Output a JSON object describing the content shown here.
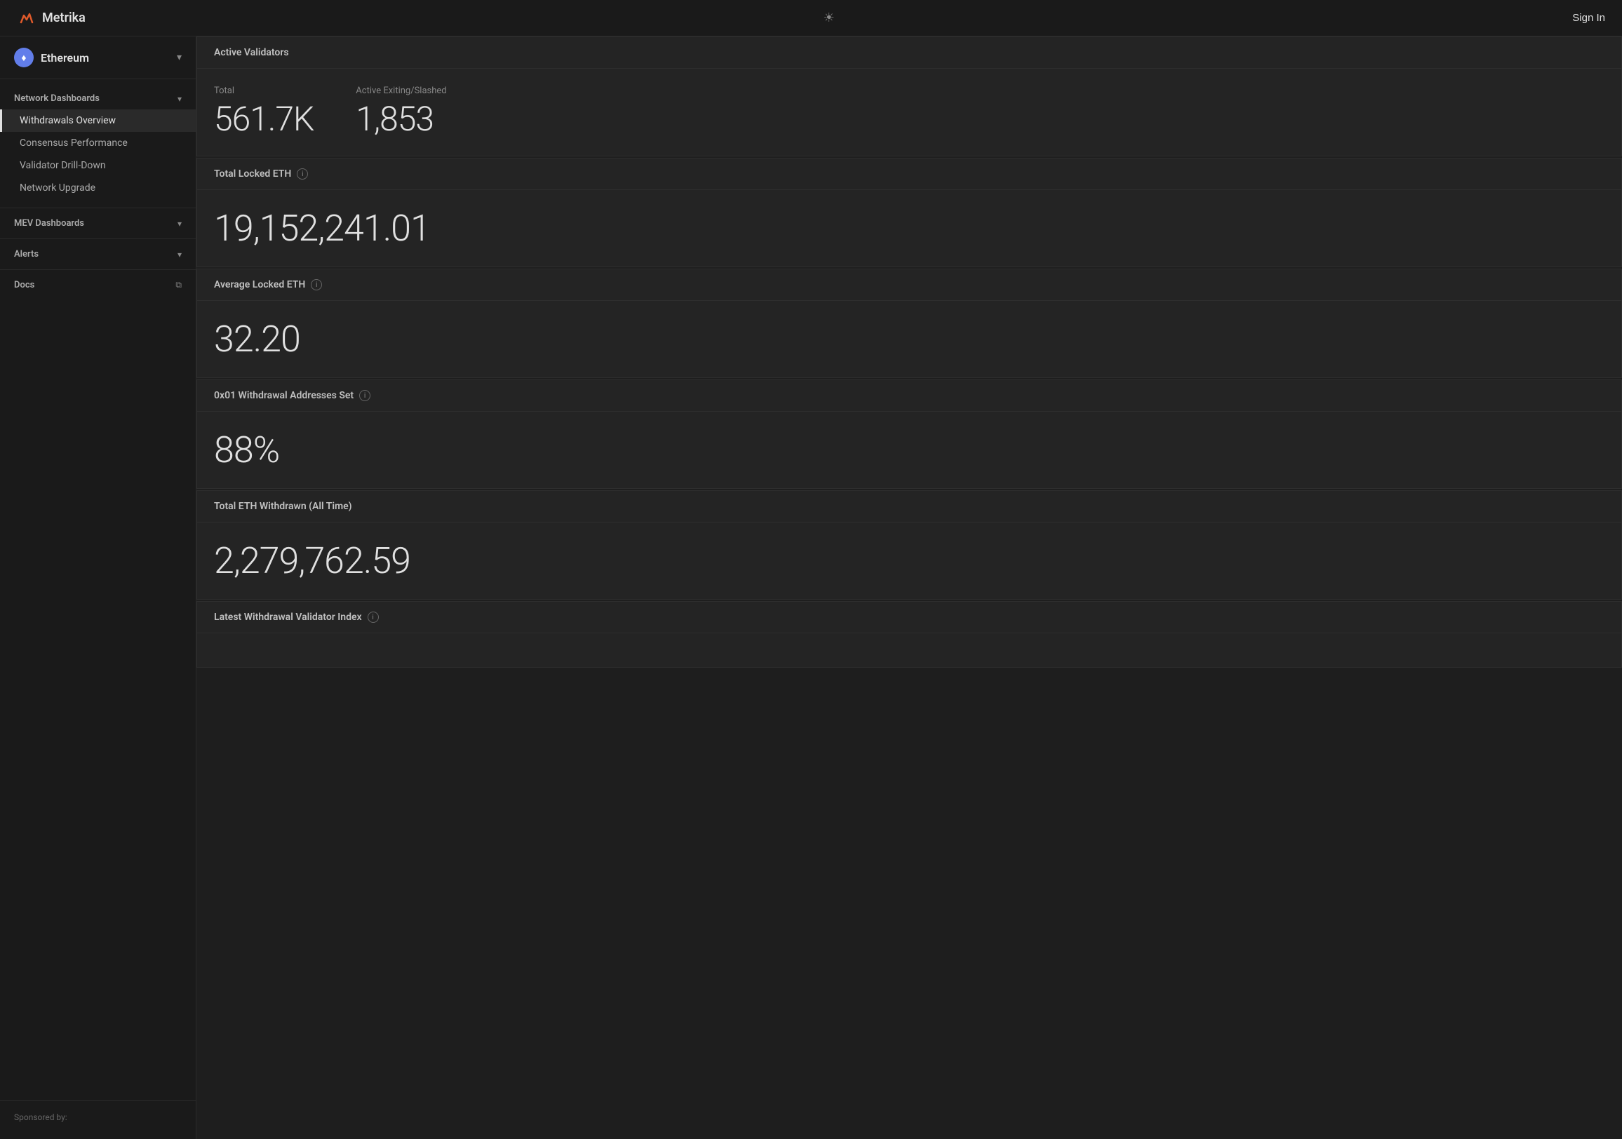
{
  "app": {
    "name": "Metrika",
    "sign_in_label": "Sign In"
  },
  "theme_icon": "☀",
  "network_selector": {
    "name": "Ethereum",
    "chevron": "▾"
  },
  "sidebar": {
    "network_dashboards_label": "Network Dashboards",
    "network_dashboards_chevron": "▾",
    "nav_items": [
      {
        "label": "Withdrawals Overview",
        "active": true
      },
      {
        "label": "Consensus Performance",
        "active": false
      },
      {
        "label": "Validator Drill-Down",
        "active": false
      },
      {
        "label": "Network Upgrade",
        "active": false
      }
    ],
    "mev_dashboards_label": "MEV Dashboards",
    "mev_dashboards_chevron": "▾",
    "alerts_label": "Alerts",
    "alerts_chevron": "▾",
    "docs_label": "Docs",
    "docs_icon": "⧉",
    "sponsored_label": "Sponsored by:"
  },
  "metrics": [
    {
      "title": "Active Validators",
      "has_info": false,
      "type": "validators",
      "stats": [
        {
          "label": "Total",
          "value": "561.7K"
        },
        {
          "label": "Active Exiting/Slashed",
          "value": "1,853"
        }
      ]
    },
    {
      "title": "Total Locked ETH",
      "has_info": true,
      "type": "single",
      "value": "19,152,241.01"
    },
    {
      "title": "Average Locked ETH",
      "has_info": true,
      "type": "single",
      "value": "32.20"
    },
    {
      "title": "0x01 Withdrawal Addresses Set",
      "has_info": true,
      "type": "single",
      "value": "88%"
    },
    {
      "title": "Total ETH Withdrawn (All Time)",
      "has_info": false,
      "type": "single",
      "value": "2,279,762.59"
    },
    {
      "title": "Latest Withdrawal Validator Index",
      "has_info": true,
      "type": "single",
      "value": ""
    }
  ]
}
